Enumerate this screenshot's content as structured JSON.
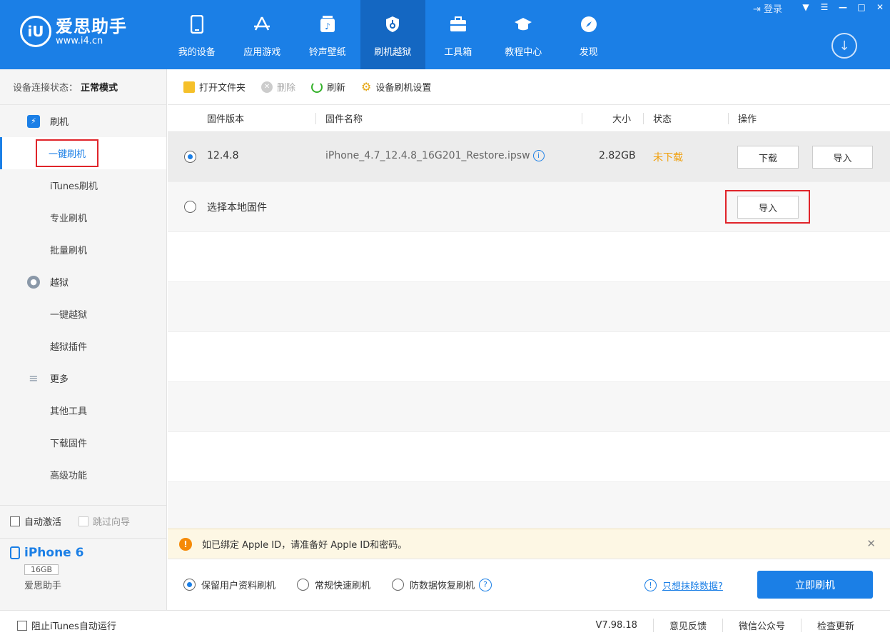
{
  "header": {
    "logo_mark": "iU",
    "logo_name": "爱思助手",
    "logo_url": "www.i4.cn",
    "login": "登录",
    "nav": [
      {
        "label": "我的设备",
        "icon": "phone-icon"
      },
      {
        "label": "应用游戏",
        "icon": "app-store-icon"
      },
      {
        "label": "铃声壁纸",
        "icon": "music-icon"
      },
      {
        "label": "刷机越狱",
        "icon": "shield-icon"
      },
      {
        "label": "工具箱",
        "icon": "toolbox-icon"
      },
      {
        "label": "教程中心",
        "icon": "graduation-cap-icon"
      },
      {
        "label": "发现",
        "icon": "compass-icon"
      }
    ],
    "active_nav": "刷机越狱"
  },
  "sidebar": {
    "conn_label": "设备连接状态：",
    "conn_value": "正常模式",
    "flash_group": "刷机",
    "items": [
      "一键刷机",
      "iTunes刷机",
      "专业刷机",
      "批量刷机"
    ],
    "jailbreak_group": "越狱",
    "jb_items": [
      "一键越狱",
      "越狱插件"
    ],
    "more_group": "更多",
    "more_items": [
      "其他工具",
      "下载固件",
      "高级功能"
    ],
    "auto_activate": "自动激活",
    "skip_guide": "跳过向导",
    "device_name": "iPhone 6",
    "device_capacity": "16GB",
    "device_sub": "爱思助手"
  },
  "toolbar": {
    "open_folder": "打开文件夹",
    "delete": "删除",
    "refresh": "刷新",
    "settings": "设备刷机设置"
  },
  "table": {
    "headers": {
      "version": "固件版本",
      "name": "固件名称",
      "size": "大小",
      "status": "状态",
      "action": "操作"
    },
    "rows": [
      {
        "version": "12.4.8",
        "name": "iPhone_4.7_12.4.8_16G201_Restore.ipsw",
        "size": "2.82GB",
        "status": "未下载",
        "download": "下载",
        "import": "导入"
      }
    ],
    "local": {
      "label": "选择本地固件",
      "import": "导入"
    }
  },
  "notice": {
    "text": "如已绑定 Apple ID，请准备好 Apple ID和密码。",
    "close": "✕"
  },
  "options": {
    "keep_data": "保留用户资料刷机",
    "quick": "常规快速刷机",
    "anti_recovery": "防数据恢复刷机",
    "erase_link": "只想抹除数据?",
    "flash_now": "立即刷机"
  },
  "status": {
    "block_itunes": "阻止iTunes自动运行",
    "version": "V7.98.18",
    "feedback": "意见反馈",
    "wechat": "微信公众号",
    "update": "检查更新"
  },
  "colors": {
    "primary": "#1b7fe6",
    "warning": "#f58a07",
    "highlight": "#e0242a"
  }
}
